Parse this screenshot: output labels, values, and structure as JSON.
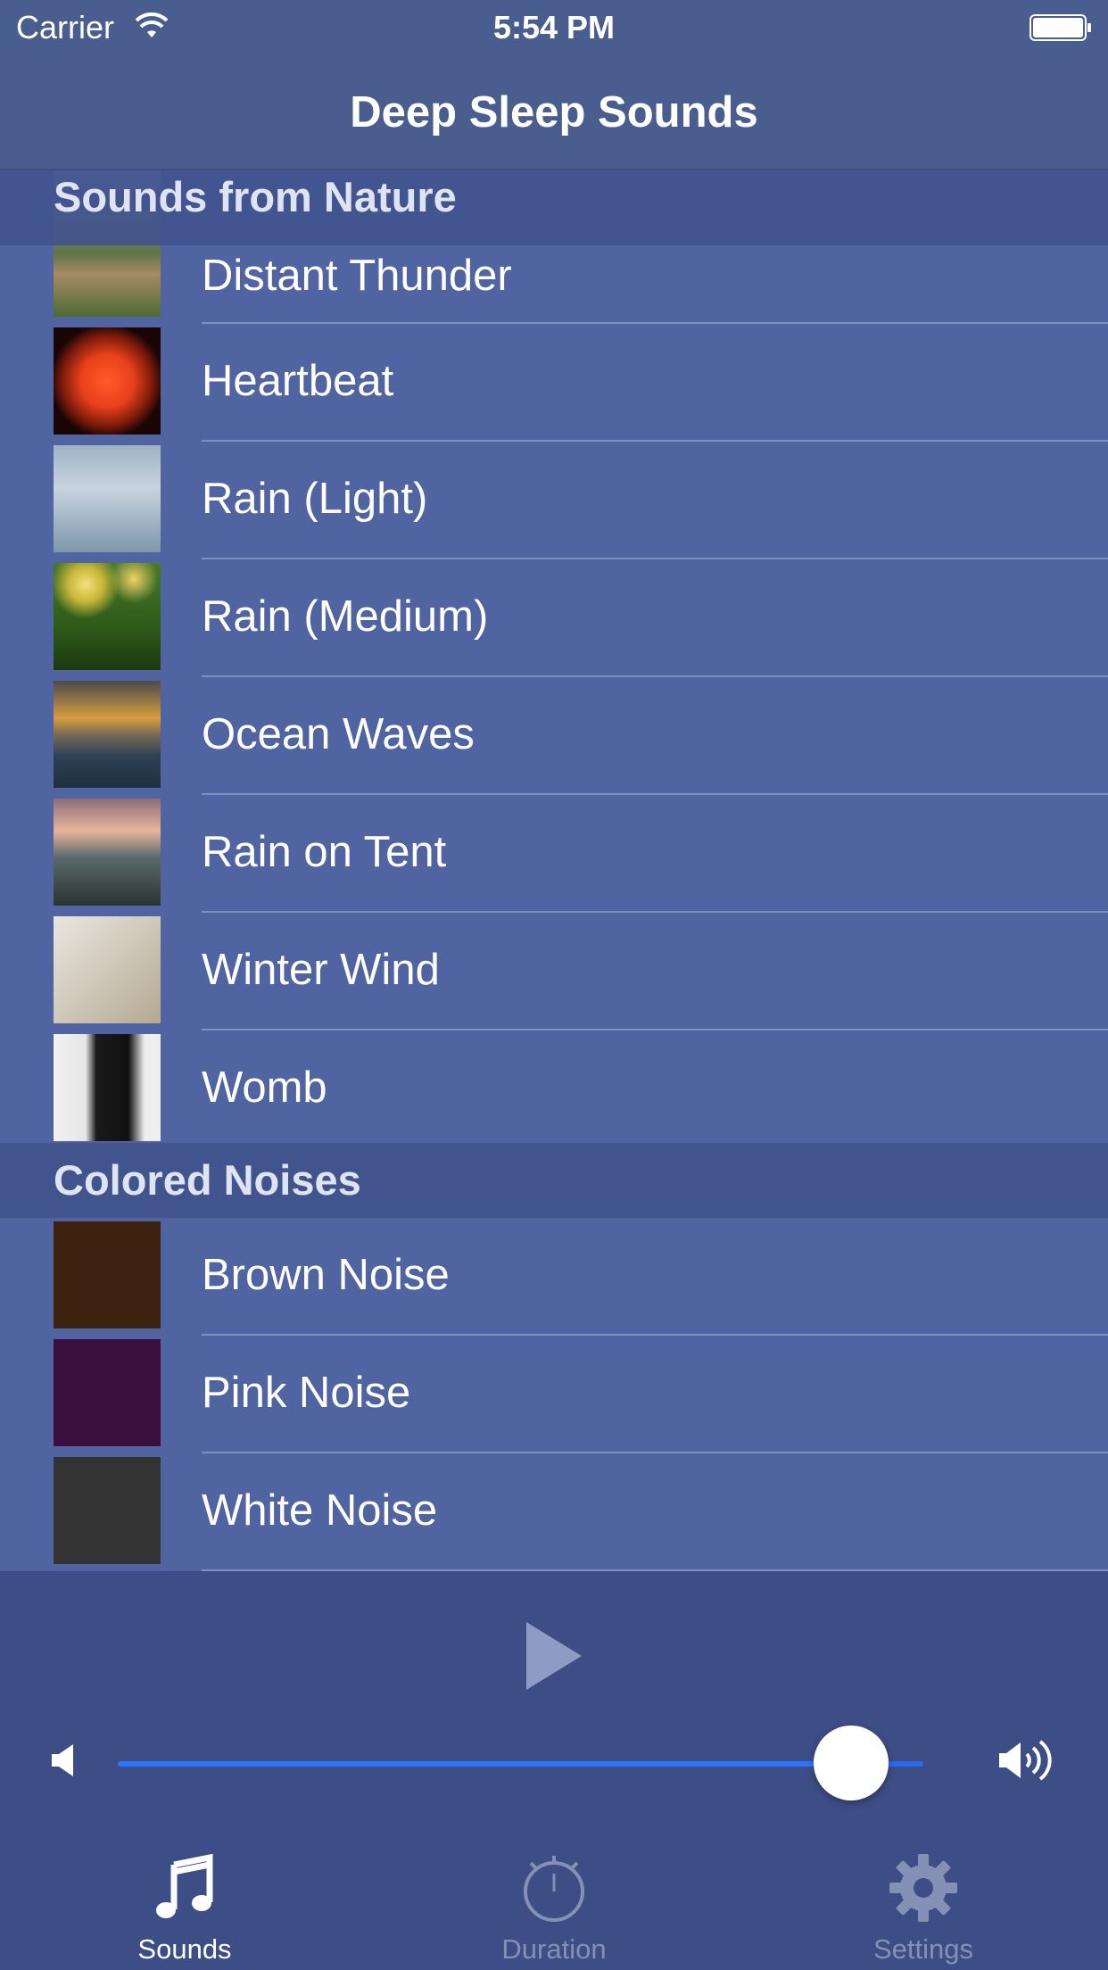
{
  "status_bar": {
    "carrier": "Carrier",
    "time": "5:54 PM"
  },
  "nav": {
    "title": "Deep Sleep Sounds"
  },
  "sections": [
    {
      "title": "Sounds from Nature",
      "items": [
        {
          "label": "Distant Thunder",
          "icon": "thunder-thumb"
        },
        {
          "label": "Heartbeat",
          "icon": "heart-thumb"
        },
        {
          "label": "Rain (Light)",
          "icon": "rain-light-thumb"
        },
        {
          "label": "Rain (Medium)",
          "icon": "rain-medium-thumb"
        },
        {
          "label": "Ocean Waves",
          "icon": "ocean-thumb"
        },
        {
          "label": "Rain on Tent",
          "icon": "tent-thumb"
        },
        {
          "label": "Winter Wind",
          "icon": "wind-thumb"
        },
        {
          "label": "Womb",
          "icon": "womb-thumb"
        }
      ]
    },
    {
      "title": "Colored Noises",
      "items": [
        {
          "label": "Brown Noise",
          "icon": "brown-thumb"
        },
        {
          "label": "Pink Noise",
          "icon": "pink-thumb"
        },
        {
          "label": "White Noise",
          "icon": "white-thumb"
        }
      ]
    }
  ],
  "player": {
    "volume_fraction": 0.91,
    "accent_color": "#2a75ff"
  },
  "tabs": [
    {
      "label": "Sounds",
      "icon": "music-note-icon",
      "active": true
    },
    {
      "label": "Duration",
      "icon": "stopwatch-icon",
      "active": false
    },
    {
      "label": "Settings",
      "icon": "gear-icon",
      "active": false
    }
  ],
  "colors": {
    "background": "#4f64a0",
    "section_header": "#42548e",
    "bar": "#3d4d85"
  }
}
